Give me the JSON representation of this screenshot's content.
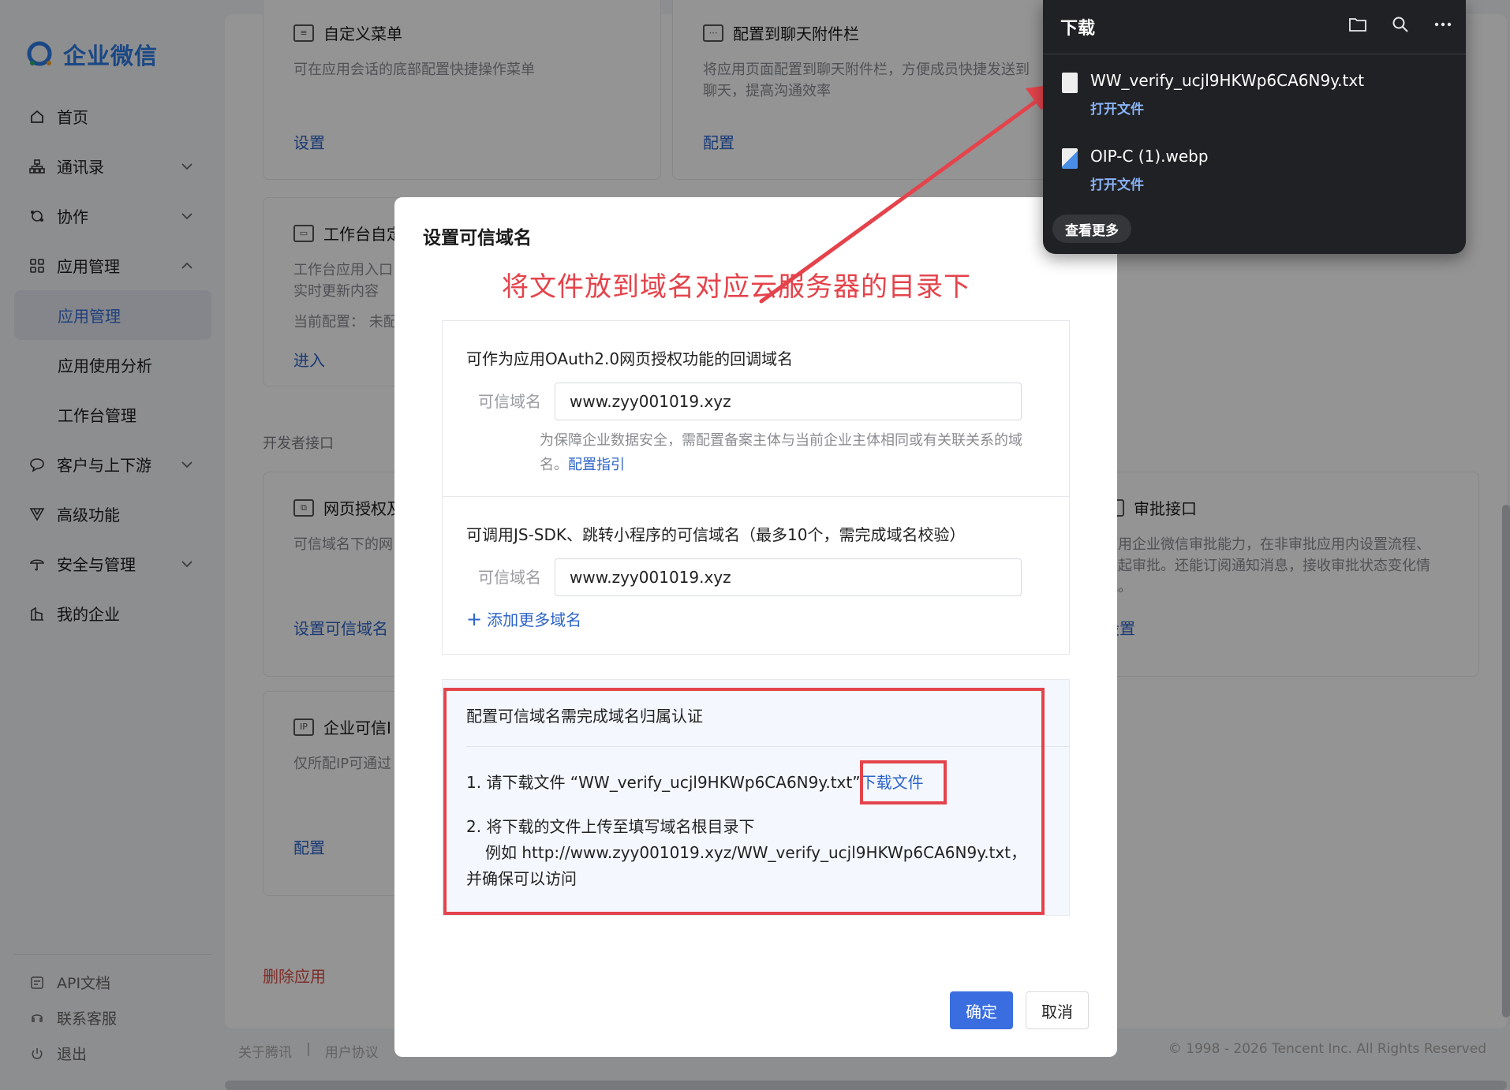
{
  "sidebar": {
    "logo_text": "企业微信",
    "items": [
      {
        "label": "首页"
      },
      {
        "label": "通讯录"
      },
      {
        "label": "协作"
      },
      {
        "label": "应用管理"
      },
      {
        "label": "应用管理"
      },
      {
        "label": "应用使用分析"
      },
      {
        "label": "工作台管理"
      },
      {
        "label": "客户与上下游"
      },
      {
        "label": "高级功能"
      },
      {
        "label": "安全与管理"
      },
      {
        "label": "我的企业"
      }
    ],
    "bottom_items": [
      {
        "label": "API文档"
      },
      {
        "label": "联系客服"
      },
      {
        "label": "退出"
      }
    ]
  },
  "background": {
    "cards": [
      {
        "title": "自定义菜单",
        "desc": "可在应用会话的底部配置快捷操作菜单",
        "link": "设置"
      },
      {
        "title": "配置到聊天附件栏",
        "desc": "将应用页面配置到聊天附件栏，方便成员快捷发送到聊天，提高沟通效率",
        "link": "配置"
      },
      {
        "title": "工作台自定",
        "desc": "工作台应用入口实时更新内容",
        "desc2": "当前配置：  未配",
        "link": "进入"
      },
      {
        "title": "网页授权及",
        "desc": "可信域名下的网",
        "link": "设置可信域名"
      },
      {
        "title": "审批接口",
        "desc": "使用企业微信审批能力，在非审批应用内设置流程、发起审批。还能订阅通知消息，接收审批状态变化情况。",
        "link": "设置"
      },
      {
        "title": "企业可信I",
        "desc": "仅所配IP可通过",
        "link": "配置"
      }
    ],
    "section_label": "开发者接口",
    "delete_link": "删除应用",
    "footer_links": [
      "关于腾讯",
      "用户协议"
    ],
    "copyright": "© 1998 - 2026 Tencent Inc. All Rights Reserved"
  },
  "modal": {
    "title": "设置可信域名",
    "oauth_section": {
      "heading": "可作为应用OAuth2.0网页授权功能的回调域名",
      "label": "可信域名",
      "value": "www.zyy001019.xyz",
      "hint": "为保障企业数据安全，需配置备案主体与当前企业主体相同或有关联关系的域名。",
      "hint_link": "配置指引"
    },
    "jssdk_section": {
      "heading": "可调用JS-SDK、跳转小程序的可信域名（最多10个，需完成域名校验）",
      "label": "可信域名",
      "value": "www.zyy001019.xyz",
      "add_link": "添加更多域名"
    },
    "verify_section": {
      "heading": "配置可信域名需完成域名归属认证",
      "step1_text": "1. 请下载文件 “WW_verify_ucjl9HKWp6CA6N9y.txt”",
      "step1_link": "下载文件",
      "step2_line1": "2. 将下载的文件上传至填写域名根目录下",
      "step2_line2": "例如 http://www.zyy001019.xyz/WW_verify_ucjl9HKWp6CA6N9y.txt，",
      "step2_line3": "并确保可以访问"
    },
    "ok_label": "确定",
    "cancel_label": "取消"
  },
  "annotation": {
    "text": "将文件放到域名对应云服务器的目录下",
    "color": "#e4434b"
  },
  "downloads": {
    "title": "下载",
    "items": [
      {
        "name": "WW_verify_ucjl9HKWp6CA6N9y.txt",
        "action": "打开文件",
        "icon": "text-file-icon"
      },
      {
        "name": "OIP-C (1).webp",
        "action": "打开文件",
        "icon": "image-file-icon"
      }
    ],
    "more_label": "查看更多"
  }
}
